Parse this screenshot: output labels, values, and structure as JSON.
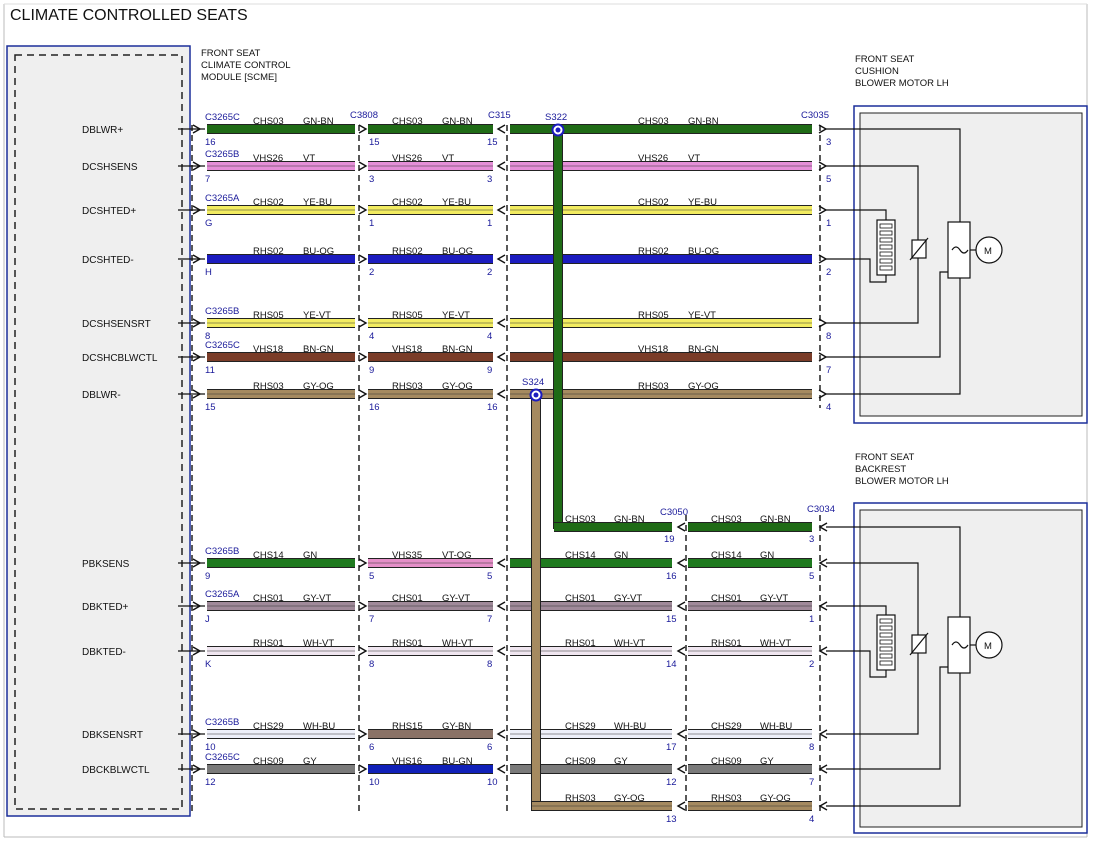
{
  "title": "CLIMATE CONTROLLED SEATS",
  "module": {
    "line1": "FRONT SEAT",
    "line2": "CLIMATE CONTROL",
    "line3": "MODULE [SCME]"
  },
  "cushion_motor": {
    "line1": "FRONT SEAT",
    "line2": "CUSHION",
    "line3": "BLOWER MOTOR LH",
    "motor": "M"
  },
  "backrest_motor": {
    "line1": "FRONT SEAT",
    "line2": "BACKREST",
    "line3": "BLOWER MOTOR LH",
    "motor": "M"
  },
  "splices": {
    "s322": "S322",
    "s324": "S324"
  },
  "connectors": {
    "c3808": "C3808",
    "c315": "C315",
    "c3035": "C3035",
    "c3050": "C3050",
    "c3034": "C3034"
  },
  "colors": {
    "GN-BN": "#1f6b16",
    "VT": "#e58fd8",
    "YE-BU": "#f2ec61",
    "BU-OG": "#1c1cbf",
    "YE-VT": "#f2ec61",
    "BN-GN": "#7a3c28",
    "GY-OG": "#a58a60",
    "GN": "#1f7a1f",
    "VT-OG": "#e58fc8",
    "GY-VT": "#a08a9a",
    "WH-VT": "#f0e6f0",
    "WH-BU": "#eef0fa",
    "GY-BN": "#8a7266",
    "GY": "#7a7a7a",
    "BU-GN": "#1020b8"
  },
  "upper": [
    {
      "signal": "DBLWR+",
      "conn": "C3265C",
      "pin1": "16",
      "c1": "CHS03",
      "col1": "GN-BN",
      "pin2a": "15",
      "c2": "CHS03",
      "col2": "GN-BN",
      "pin2b": "15",
      "c3": "CHS03",
      "col3": "GN-BN",
      "pin3": "3"
    },
    {
      "signal": "DCSHSENS",
      "conn": "C3265B",
      "pin1": "7",
      "c1": "VHS26",
      "col1": "VT",
      "pin2a": "3",
      "c2": "VHS26",
      "col2": "VT",
      "pin2b": "3",
      "c3": "VHS26",
      "col3": "VT",
      "pin3": "5"
    },
    {
      "signal": "DCSHTED+",
      "conn": "C3265A",
      "pin1": "G",
      "c1": "CHS02",
      "col1": "YE-BU",
      "pin2a": "1",
      "c2": "CHS02",
      "col2": "YE-BU",
      "pin2b": "1",
      "c3": "CHS02",
      "col3": "YE-BU",
      "pin3": "1"
    },
    {
      "signal": "DCSHTED-",
      "conn": "",
      "pin1": "H",
      "c1": "RHS02",
      "col1": "BU-OG",
      "pin2a": "2",
      "c2": "RHS02",
      "col2": "BU-OG",
      "pin2b": "2",
      "c3": "RHS02",
      "col3": "BU-OG",
      "pin3": "2"
    },
    {
      "signal": "DCSHSENSRT",
      "conn": "C3265B",
      "pin1": "8",
      "c1": "RHS05",
      "col1": "YE-VT",
      "pin2a": "4",
      "c2": "RHS05",
      "col2": "YE-VT",
      "pin2b": "4",
      "c3": "RHS05",
      "col3": "YE-VT",
      "pin3": "8"
    },
    {
      "signal": "DCSHCBLWCTL",
      "conn": "C3265C",
      "pin1": "11",
      "c1": "VHS18",
      "col1": "BN-GN",
      "pin2a": "9",
      "c2": "VHS18",
      "col2": "BN-GN",
      "pin2b": "9",
      "c3": "VHS18",
      "col3": "BN-GN",
      "pin3": "7"
    },
    {
      "signal": "DBLWR-",
      "conn": "",
      "pin1": "15",
      "c1": "RHS03",
      "col1": "GY-OG",
      "pin2a": "16",
      "c2": "RHS03",
      "col2": "GY-OG",
      "pin2b": "16",
      "c3": "RHS03",
      "col3": "GY-OG",
      "pin3": "4"
    }
  ],
  "lower": [
    {
      "signal": "PBKSENS",
      "conn": "C3265B",
      "pin1": "9",
      "c1": "CHS14",
      "col1": "GN",
      "pin2a": "5",
      "c2": "VHS35",
      "col2": "VT-OG",
      "pin2b": "5",
      "c3": "CHS14",
      "col3": "GN",
      "pin3": "16",
      "c4": "CHS14",
      "col4": "GN",
      "pin4": "5"
    },
    {
      "signal": "DBKTED+",
      "conn": "C3265A",
      "pin1": "J",
      "c1": "CHS01",
      "col1": "GY-VT",
      "pin2a": "7",
      "c2": "CHS01",
      "col2": "GY-VT",
      "pin2b": "7",
      "c3": "CHS01",
      "col3": "GY-VT",
      "pin3": "15",
      "c4": "CHS01",
      "col4": "GY-VT",
      "pin4": "1"
    },
    {
      "signal": "DBKTED-",
      "conn": "",
      "pin1": "K",
      "c1": "RHS01",
      "col1": "WH-VT",
      "pin2a": "8",
      "c2": "RHS01",
      "col2": "WH-VT",
      "pin2b": "8",
      "c3": "RHS01",
      "col3": "WH-VT",
      "pin3": "14",
      "c4": "RHS01",
      "col4": "WH-VT",
      "pin4": "2"
    },
    {
      "signal": "DBKSENSRT",
      "conn": "C3265B",
      "pin1": "10",
      "c1": "CHS29",
      "col1": "WH-BU",
      "pin2a": "6",
      "c2": "RHS15",
      "col2": "GY-BN",
      "pin2b": "6",
      "c3": "CHS29",
      "col3": "WH-BU",
      "pin3": "17",
      "c4": "CHS29",
      "col4": "WH-BU",
      "pin4": "8"
    },
    {
      "signal": "DBCKBLWCTL",
      "conn": "C3265C",
      "pin1": "12",
      "c1": "CHS09",
      "col1": "GY",
      "pin2a": "10",
      "c2": "VHS16",
      "col2": "BU-GN",
      "pin2b": "10",
      "c3": "CHS09",
      "col3": "GY",
      "pin3": "12",
      "c4": "CHS09",
      "col4": "GY",
      "pin4": "7"
    }
  ],
  "branch_gn": {
    "c": "CHS03",
    "col": "GN-BN",
    "pin3": "19",
    "c4": "CHS03",
    "col4": "GN-BN",
    "pin4": "3"
  },
  "branch_og": {
    "c": "RHS03",
    "col": "GY-OG",
    "pin3": "13",
    "c4": "RHS03",
    "col4": "GY-OG",
    "pin4": "4"
  }
}
